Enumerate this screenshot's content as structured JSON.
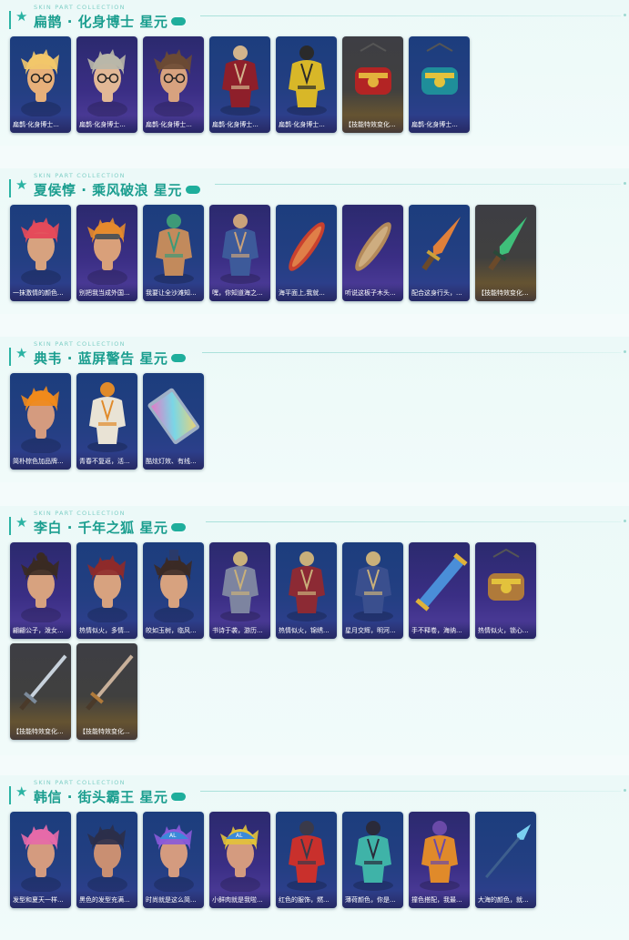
{
  "kicker": "SKIN PART COLLECTION",
  "sections": [
    {
      "title": "扁鹊 · 化身博士 星元",
      "items": [
        {
          "caption": "扁鹊·化身博士...",
          "icon": "blonde-head-with-glasses",
          "bg": "blue"
        },
        {
          "caption": "扁鹊·化身博士...",
          "icon": "gray-hair-head-with-glasses",
          "bg": "purple"
        },
        {
          "caption": "扁鹊·化身博士...",
          "icon": "brown-hair-head-with-glasses",
          "bg": "purple"
        },
        {
          "caption": "扁鹊·化身博士...",
          "icon": "red-plague-doctor-outfit",
          "bg": "blue"
        },
        {
          "caption": "扁鹊·化身博士...",
          "icon": "yellow-plague-doctor-outfit",
          "bg": "blue"
        },
        {
          "caption": "【技能特效变化...",
          "icon": "red-gold-lantern",
          "bg": "gold"
        },
        {
          "caption": "扁鹊·化身博士...",
          "icon": "teal-gold-lantern",
          "bg": "blue"
        }
      ]
    },
    {
      "title": "夏侯惇 · 乘风破浪 星元",
      "items": [
        {
          "caption": "一抹激情的颜色...",
          "icon": "red-headband-head",
          "bg": "blue"
        },
        {
          "caption": "别把我当成外国...",
          "icon": "orange-hair-goggles-head",
          "bg": "purple"
        },
        {
          "caption": "我要让全沙滩知...",
          "icon": "surfer-shirtless-outfit",
          "bg": "blue"
        },
        {
          "caption": "嘿，你知道海之...",
          "icon": "blue-robe-outfit",
          "bg": "purple"
        },
        {
          "caption": "海平面上,我就...",
          "icon": "red-surfboard",
          "bg": "blue"
        },
        {
          "caption": "听说这板子木头...",
          "icon": "wooden-surfboard",
          "bg": "purple"
        },
        {
          "caption": "配合这身行头，...",
          "icon": "orange-blade",
          "bg": "blue"
        },
        {
          "caption": "【技能特效变化...",
          "icon": "green-blade",
          "bg": "gold"
        }
      ]
    },
    {
      "title": "典韦 · 蓝屏警告 星元",
      "items": [
        {
          "caption": "简朴棕色加品牌...",
          "icon": "spiky-orange-hair-head",
          "bg": "blue"
        },
        {
          "caption": "青春不复返，活...",
          "icon": "white-orange-jacket",
          "bg": "blue"
        },
        {
          "caption": "酷炫灯效、有线...",
          "icon": "rainbow-keyboard",
          "bg": "blue"
        }
      ]
    },
    {
      "title": "李白 · 千年之狐 星元",
      "items": [
        {
          "caption": "翩翩公子，泼女...",
          "icon": "topknot-head",
          "bg": "purple"
        },
        {
          "caption": "热情似火，多情...",
          "icon": "red-hair-head",
          "bg": "blue"
        },
        {
          "caption": "皎如玉树，临风...",
          "icon": "long-hair-hat-head",
          "bg": "blue"
        },
        {
          "caption": "书诗于袭，游历...",
          "icon": "gray-armor-outfit",
          "bg": "purple"
        },
        {
          "caption": "热情似火，锦绣...",
          "icon": "red-armor-outfit",
          "bg": "blue"
        },
        {
          "caption": "星月交辉，明河...",
          "icon": "blue-armor-outfit",
          "bg": "blue"
        },
        {
          "caption": "手不释卷，海纳...",
          "icon": "blue-scroll",
          "bg": "purple"
        },
        {
          "caption": "热情似火，锁心...",
          "icon": "bronze-lantern",
          "bg": "purple"
        },
        {
          "caption": "【技能特效变化...",
          "icon": "silver-sword",
          "bg": "gold"
        },
        {
          "caption": "【技能特效变化...",
          "icon": "bronze-sword",
          "bg": "gold"
        }
      ]
    },
    {
      "title": "韩信 · 街头霸王 星元",
      "items": [
        {
          "caption": "发型和夏天一样...",
          "icon": "pink-hair-head",
          "bg": "blue"
        },
        {
          "caption": "黑色的发型充满...",
          "icon": "dark-spiky-hair-head",
          "bg": "blue"
        },
        {
          "caption": "时尚就是这么简...",
          "icon": "purple-hair-cap-head",
          "bg": "blue"
        },
        {
          "caption": "小鲜肉就是我啦...",
          "icon": "yellow-hair-cap-head",
          "bg": "purple"
        },
        {
          "caption": "红色的服饰，燃...",
          "icon": "red-jacket-outfit",
          "bg": "blue"
        },
        {
          "caption": "薄荷颜色，你是...",
          "icon": "teal-jacket-outfit",
          "bg": "blue"
        },
        {
          "caption": "撞色搭配，我最...",
          "icon": "orange-purple-jacket",
          "bg": "purple"
        },
        {
          "caption": "大海的颜色，就...",
          "icon": "blue-spear",
          "bg": "blue"
        }
      ]
    }
  ]
}
